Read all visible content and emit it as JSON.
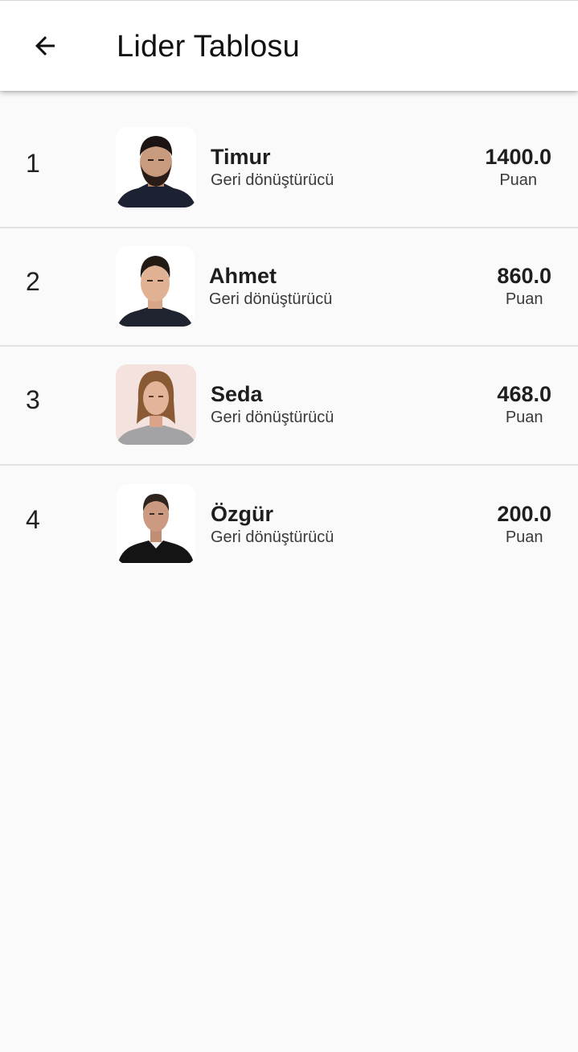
{
  "appbar": {
    "title": "Lider Tablosu",
    "back_icon": "arrow-back-icon"
  },
  "leaderboard": [
    {
      "rank": "1",
      "name": "Timur",
      "role": "Geri dönüştürücü",
      "score": "1400.0",
      "unit": "Puan"
    },
    {
      "rank": "2",
      "name": "Ahmet",
      "role": "Geri dönüştürücü",
      "score": "860.0",
      "unit": "Puan"
    },
    {
      "rank": "3",
      "name": "Seda",
      "role": "Geri dönüştürücü",
      "score": "468.0",
      "unit": "Puan"
    },
    {
      "rank": "4",
      "name": "Özgür",
      "role": "Geri dönüştürücü",
      "score": "200.0",
      "unit": "Puan"
    }
  ],
  "colors": {
    "background": "#fafafa",
    "appbar": "#ffffff",
    "divider": "#e2e2e2",
    "text_primary": "#1e1e1e",
    "text_secondary": "#3a3a3a"
  }
}
